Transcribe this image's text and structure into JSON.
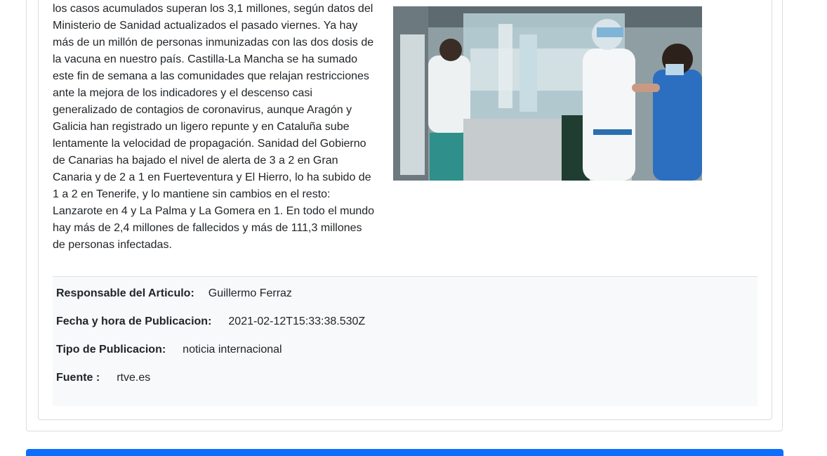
{
  "article": {
    "body": "los casos acumulados superan los 3,1 millones, según datos del Ministerio de Sanidad actualizados el pasado viernes. Ya hay más de un millón de personas inmunizadas con las dos dosis de la vacuna en nuestro país. Castilla-La Mancha se ha sumado este fin de semana a las comunidades que relajan restricciones ante la mejora de los indicadores y el descenso casi generalizado de contagios de coronavirus, aunque Aragón y Galicia han registrado un ligero repunte y en Cataluña sube lentamente la velocidad de propagación. Sanidad del Gobierno de Canarias ha bajado el nivel de alerta de 3 a 2 en Gran Canaria y de 2 a 1 en Fuerteventura y El Hierro, lo ha subido de 1 a 2 en Tenerife, y lo mantiene sin cambios en el resto: Lanzarote en 4 y La Palma y La Gomera en 1. En todo el mundo hay más de 2,4 millones de fallecidos y más de 111,3 millones de personas infectadas."
  },
  "meta": {
    "author_label": "Responsable del Articulo:",
    "author_value": "Guillermo Ferraz",
    "date_label": "Fecha y hora de Publicacion:",
    "date_value": "2021-02-12T15:33:38.530Z",
    "type_label": "Tipo de Publicacion:",
    "type_value": "noticia internacional",
    "source_label": "Fuente :",
    "source_value": "rtve.es"
  },
  "colors": {
    "accent": "#0d6efd",
    "meta_background": "#f8f9fa"
  }
}
